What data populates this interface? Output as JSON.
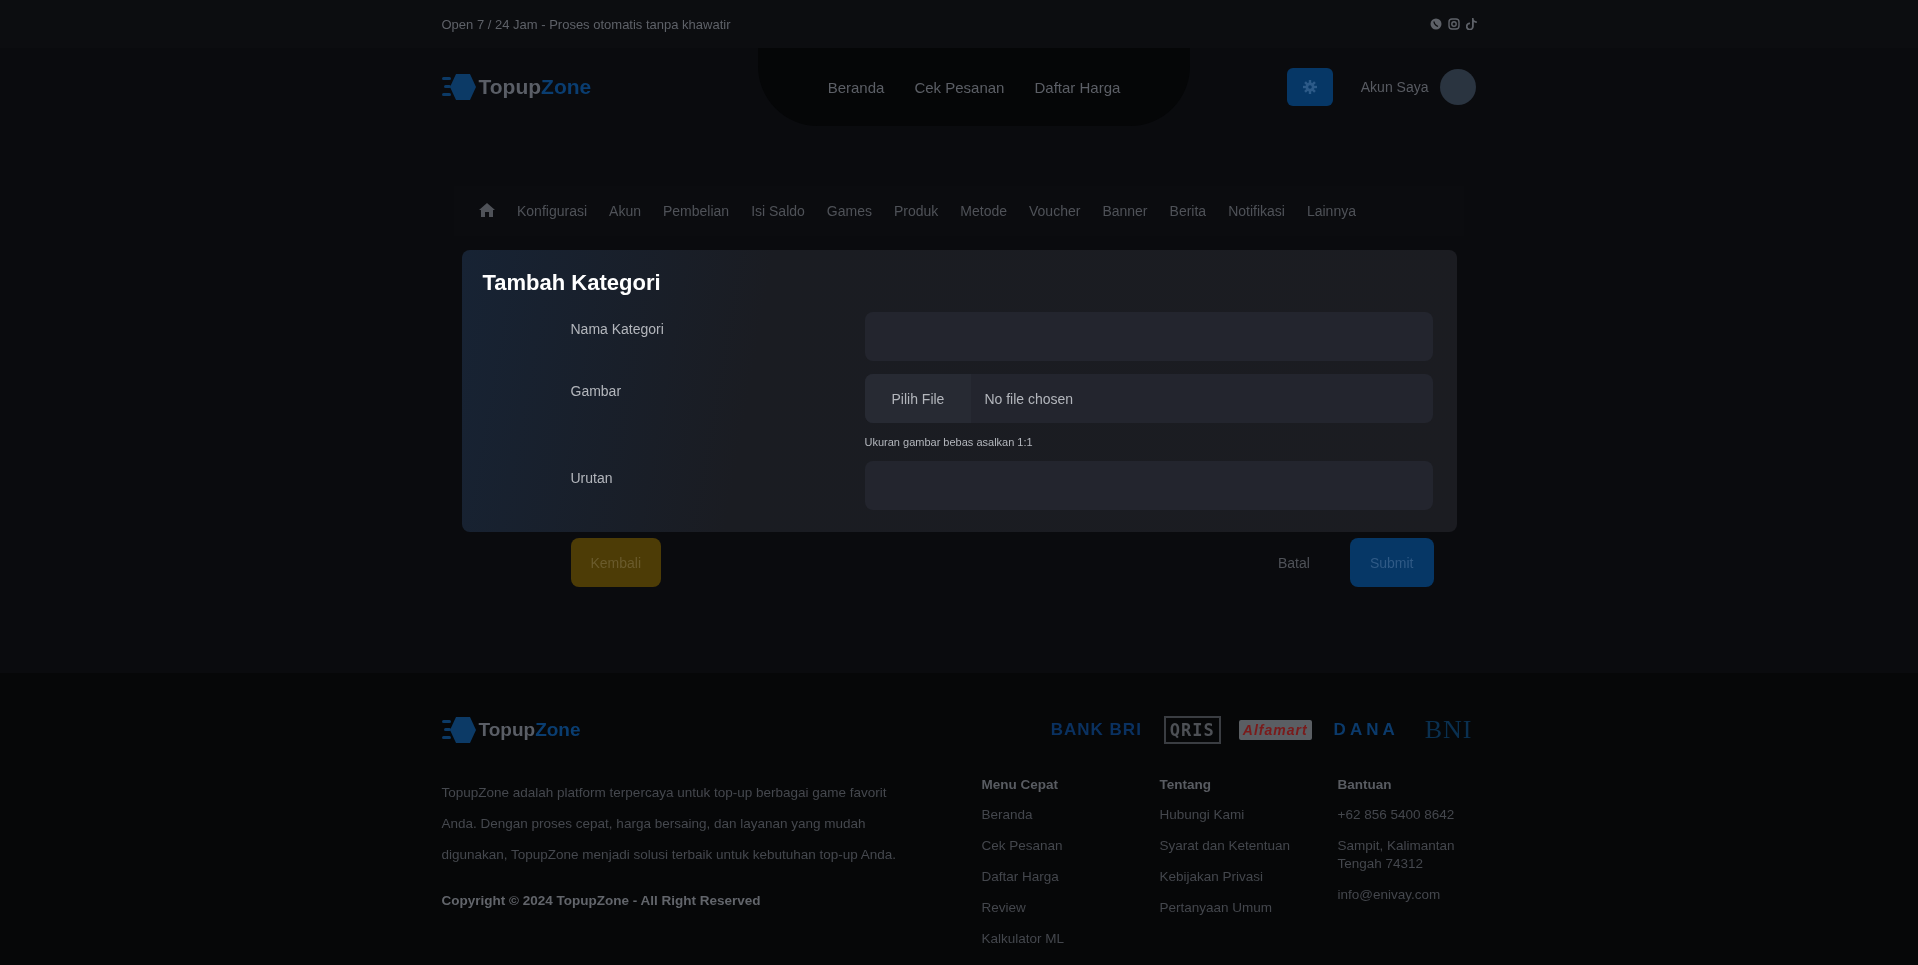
{
  "topbar": {
    "text": "Open 7 / 24 Jam - Proses otomatis tanpa khawatir"
  },
  "header": {
    "logo": {
      "text_1": "Topup",
      "text_2": "Zone"
    },
    "nav": [
      "Beranda",
      "Cek Pesanan",
      "Daftar Harga"
    ],
    "account_label": "Akun Saya"
  },
  "admin_menu": {
    "items": [
      "Konfigurasi",
      "Akun",
      "Pembelian",
      "Isi Saldo",
      "Games",
      "Produk",
      "Metode",
      "Voucher",
      "Banner",
      "Berita",
      "Notifikasi",
      "Lainnya"
    ]
  },
  "modal": {
    "title": "Tambah Kategori",
    "fields": [
      {
        "kind": "text",
        "label": "Nama Kategori"
      },
      {
        "kind": "file",
        "label": "Gambar",
        "button": "Pilih File",
        "value": "No file chosen",
        "hint": "Ukuran gambar bebas asalkan 1:1"
      },
      {
        "kind": "text",
        "label": "Urutan"
      }
    ],
    "back_button": "Kembali",
    "cancel_button": "Batal",
    "submit_button": "Submit"
  },
  "footer": {
    "logo": {
      "text_1": "Topup",
      "text_2": "Zone"
    },
    "payment_logos": [
      "BANK BRI",
      "QRIS",
      "Alfamart",
      "DANA",
      "BNI"
    ],
    "description": "TopupZone adalah platform terpercaya untuk top-up berbagai game favorit Anda. Dengan proses cepat, harga bersaing, dan layanan yang mudah digunakan, TopupZone menjadi solusi terbaik untuk kebutuhan top-up Anda.",
    "copyright": "Copyright © 2024 TopupZone - All Right Reserved",
    "columns": [
      {
        "title": "Menu Cepat",
        "links": [
          "Beranda",
          "Cek Pesanan",
          "Daftar Harga",
          "Review",
          "Kalkulator ML"
        ]
      },
      {
        "title": "Tentang",
        "links": [
          "Hubungi Kami",
          "Syarat dan Ketentuan",
          "Kebijakan Privasi",
          "Pertanyaan Umum"
        ]
      },
      {
        "title": "Bantuan",
        "links": [
          "+62 856 5400 8642",
          "Sampit, Kalimantan Tengah 74312",
          "info@enivay.com"
        ]
      }
    ]
  }
}
